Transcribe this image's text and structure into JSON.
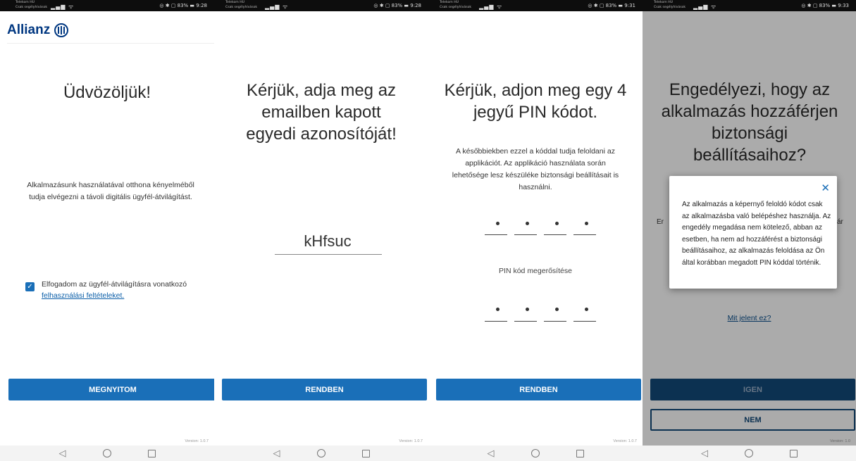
{
  "status_bars": [
    {
      "carrier": "Telekom HU\nCsak segélyhívások",
      "right": "◎ ✱ ▢ 83% ▬ 9:28"
    },
    {
      "carrier": "Telekom HU\nCsak segélyhívások",
      "right": "◎ ✱ ▢ 83% ▬ 9:28"
    },
    {
      "carrier": "Telekom HU\nCsak segélyhívások",
      "right": "◎ ✱ ▢ 83% ▬ 9:31"
    },
    {
      "carrier": "Telekom HU\nCsak segélyhívások",
      "right": "◎ ✱ ▢ 83% ▬ 9:33"
    }
  ],
  "screen1": {
    "logo": "Allianz",
    "title": "Üdvözöljük!",
    "description": "Alkalmazásunk használatával otthona kényelméből tudja elvégezni a távoli digitális ügyfél-átvilágítást.",
    "checkbox_text": "Elfogadom az ügyfél-átvilágításra vonatkozó",
    "checkbox_link": "felhasználási feltételeket.",
    "checkbox_checked": true,
    "button": "MEGNYITOM",
    "version": "Version: 1.0.7"
  },
  "screen2": {
    "title": "Kérjük, adja meg az emailben kapott egyedi azonosítóját!",
    "code_value": "kHfsuc",
    "button": "RENDBEN",
    "version": "Version: 1.0.7"
  },
  "screen3": {
    "title": "Kérjük, adjon meg egy 4 jegyű PIN kódot.",
    "description": "A későbbiekben ezzel a kóddal tudja feloldani az applikációt. Az applikáció használata során lehetősége lesz készüléke biztonsági beállításait is használni.",
    "pin_dots": "•",
    "confirm_label": "PIN kód megerősítése",
    "button": "RENDBEN",
    "version": "Version: 1.0.7"
  },
  "screen4": {
    "title": "Engedélyezi, hogy az alkalmazás hozzáférjen biztonsági beállításaihoz?",
    "frag_left": "Er",
    "frag_right": "ár",
    "dialog_close": "✕",
    "dialog_text": "Az alkalmazás a képernyő feloldó kódot csak az alkalmazásba való belépéshez használja. Az engedély megadása nem kötelező, abban az esetben, ha nem ad hozzáférést a biztonsági beállításaihoz, az alkalmazás feloldása az Ön által korábban megadott PIN kóddal történik.",
    "link": "Mit jelent ez?",
    "button_yes": "IGEN",
    "button_no": "NEM",
    "version": "Version: 1.0"
  },
  "nav": {
    "back": "◁"
  },
  "colors": {
    "brand_blue": "#003781",
    "button_blue": "#1a6fb8"
  }
}
